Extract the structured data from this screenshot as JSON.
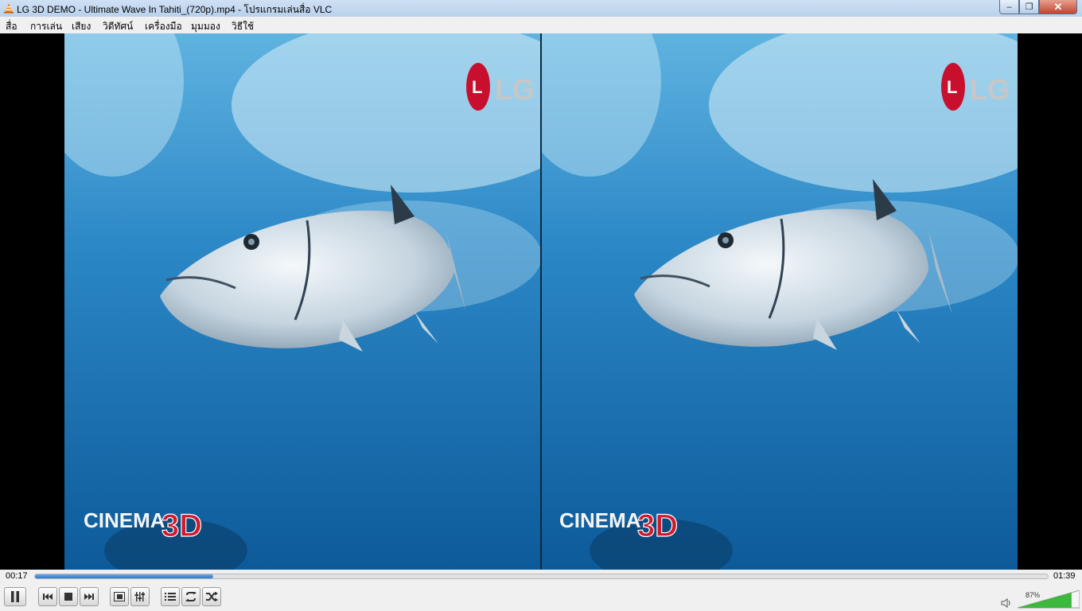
{
  "window": {
    "title": "LG 3D DEMO - Ultimate Wave In Tahiti_(720p).mp4 - โปรแกรมเล่นสื่อ VLC",
    "controls": {
      "minimize": "‒",
      "maximize": "❐",
      "close": "✕"
    }
  },
  "menu": {
    "items": [
      {
        "label": "สื่อ"
      },
      {
        "label": "การเล่น"
      },
      {
        "label": "เสียง"
      },
      {
        "label": "วิดีทัศน์"
      },
      {
        "label": "เครื่องมือ"
      },
      {
        "label": "มุมมอง"
      },
      {
        "label": "วิธีใช้"
      }
    ]
  },
  "video": {
    "logo_text": "LG",
    "badge_text": "CINEMA",
    "badge_3d": "3D"
  },
  "playback": {
    "elapsed": "00:17",
    "total": "01:39",
    "progress": 0.176
  },
  "volume": {
    "label": "87%",
    "level": 0.87
  },
  "icons": {
    "pause": "pause-icon",
    "previous": "previous-icon",
    "stop": "stop-icon",
    "next": "next-icon",
    "fullscreen": "fullscreen-icon",
    "extended_settings": "equalizer-icon",
    "playlist": "playlist-icon",
    "loop": "loop-icon",
    "random": "shuffle-icon",
    "volume": "speaker-icon"
  },
  "colors": {
    "accent": "#2f75c8",
    "water_top": "#5fb3e0",
    "water_bottom": "#0d5a99"
  }
}
